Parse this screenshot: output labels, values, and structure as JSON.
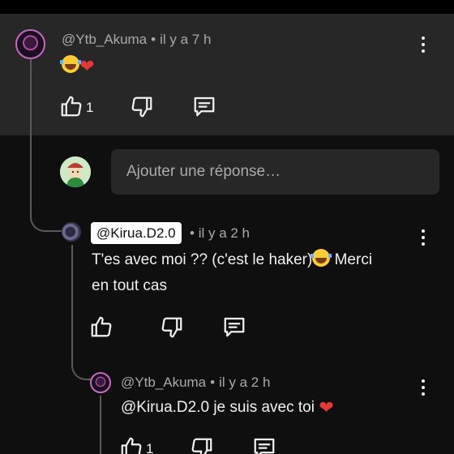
{
  "comment": {
    "author": "@Ytb_Akuma",
    "time": "il y a 7 h",
    "likes": "1",
    "emoji_text": ""
  },
  "reply_box": {
    "placeholder": "Ajouter une réponse…"
  },
  "reply1": {
    "author": "@Kirua.D2.0",
    "time": "il y a 2 h",
    "text_line1": "T'es avec moi ?? (c'est le haker)",
    "text_line1_after": " Merci",
    "text_line2": "en tout cas"
  },
  "reply2": {
    "author": "@Ytb_Akuma",
    "time": "il y a 2 h",
    "text": "@Kirua.D2.0 je suis avec toi ",
    "likes": "1"
  },
  "separator": "•",
  "icons": [
    "like-icon",
    "dislike-icon",
    "reply-icon",
    "more-vert-icon",
    "joy-emoji-icon",
    "heart-emoji-icon"
  ]
}
